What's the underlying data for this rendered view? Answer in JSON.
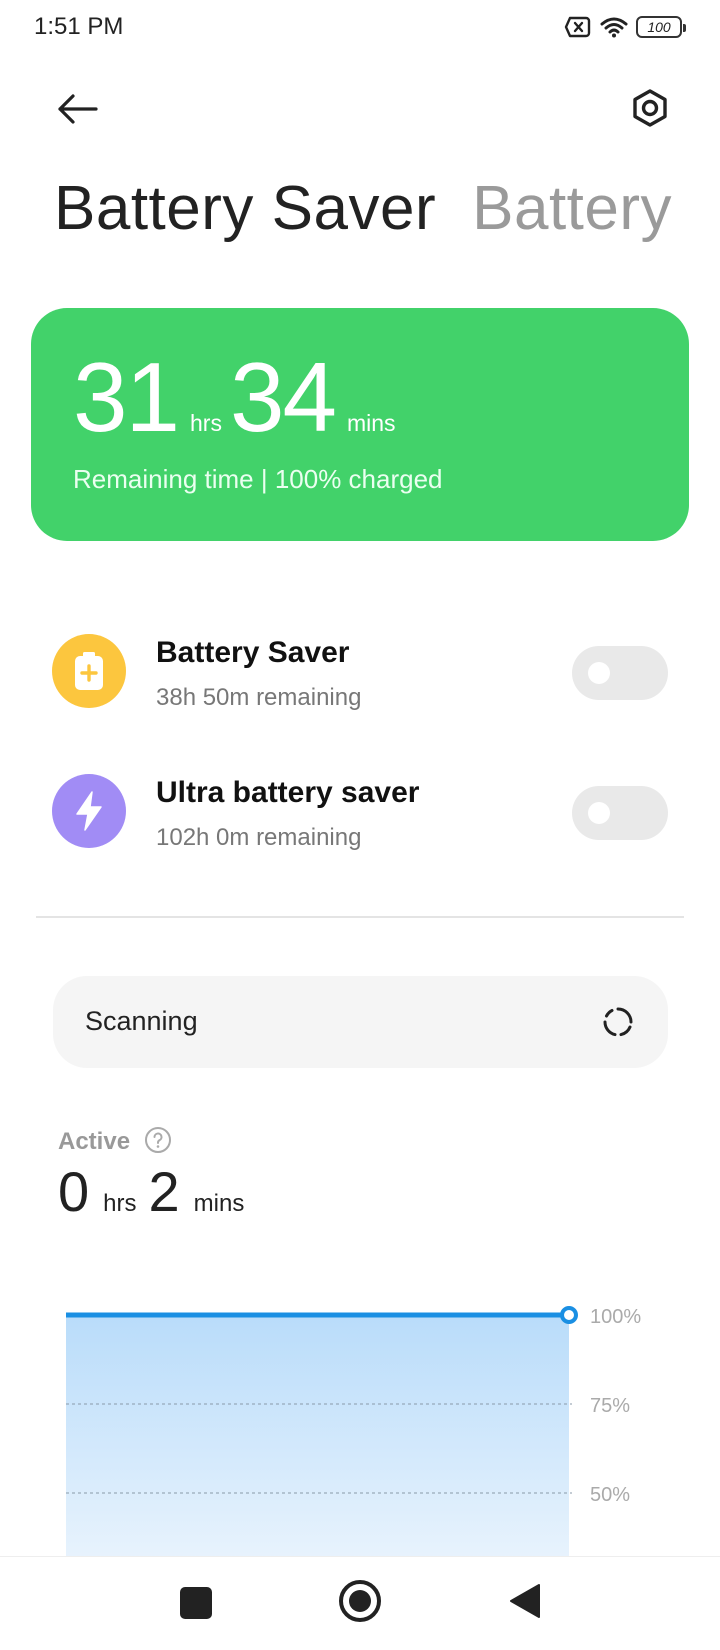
{
  "status_bar": {
    "time": "1:51 PM",
    "battery_level": "100"
  },
  "header": {
    "back_icon": "arrow-left-icon",
    "settings_icon": "gear-icon"
  },
  "tabs": [
    {
      "label": "Battery Saver",
      "active": true
    },
    {
      "label": "Battery",
      "active": false
    }
  ],
  "remaining": {
    "hours": "31",
    "hours_unit": "hrs",
    "minutes": "34",
    "minutes_unit": "mins",
    "subtitle": "Remaining time | 100% charged",
    "color": "#42d26a"
  },
  "savers": [
    {
      "title": "Battery Saver",
      "subtitle": "38h 50m remaining",
      "icon": "battery-plus-icon",
      "icon_color": "#fcc63e",
      "enabled": false
    },
    {
      "title": "Ultra battery saver",
      "subtitle": "102h 0m remaining",
      "icon": "lightning-icon",
      "icon_color": "#a18cf5",
      "enabled": false
    }
  ],
  "scan": {
    "label": "Scanning"
  },
  "active": {
    "label": "Active",
    "hours": "0",
    "hours_unit": "hrs",
    "minutes": "2",
    "minutes_unit": "mins"
  },
  "chart_data": {
    "type": "area",
    "y_tick_labels": [
      "100%",
      "75%",
      "50%"
    ],
    "y_ticks": [
      100,
      75,
      50
    ],
    "series": [
      {
        "values": [
          100,
          100
        ]
      }
    ],
    "line_color": "#1a8fe3"
  },
  "nav": {
    "recents_icon": "square-icon",
    "home_icon": "circle-icon",
    "back_icon": "triangle-back-icon"
  }
}
